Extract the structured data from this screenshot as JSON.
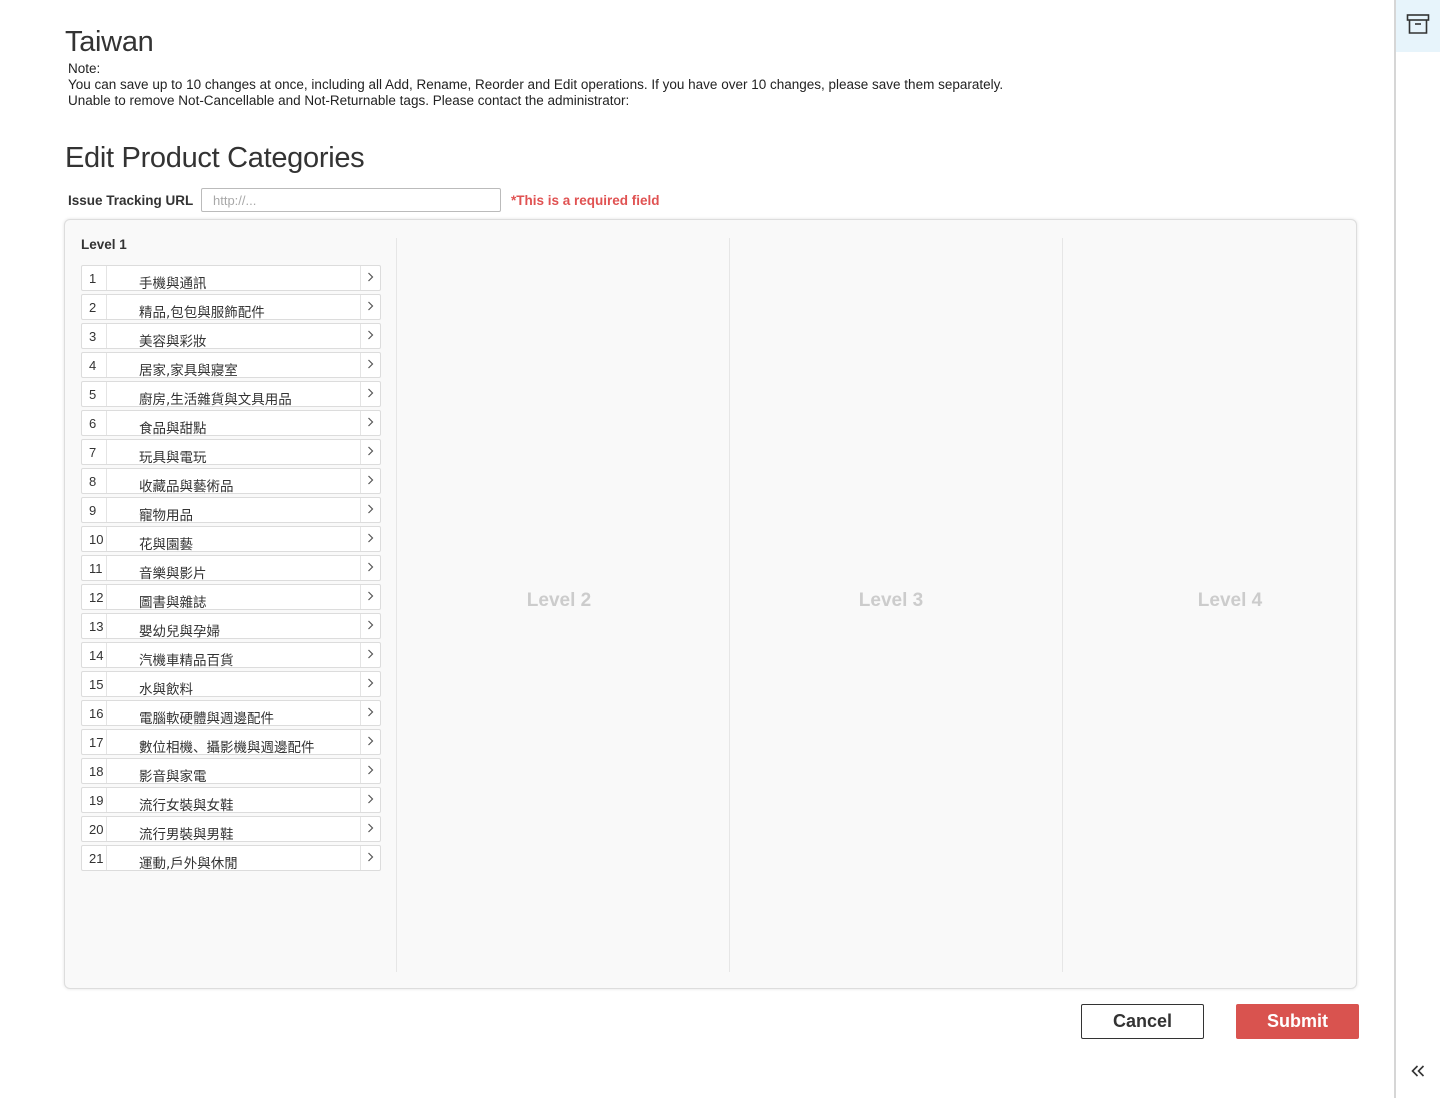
{
  "page": {
    "country_title": "Taiwan",
    "note_lines": [
      "Note:",
      "You can save up to 10 changes at once, including all Add, Rename, Reorder and Edit operations. If you have over 10 changes, please save them separately.",
      "Unable to remove Not-Cancellable and Not-Returnable tags. Please contact the administrator:"
    ],
    "section_title": "Edit Product Categories"
  },
  "tracking_url": {
    "label": "Issue Tracking URL",
    "value": "",
    "placeholder": "http://...",
    "required_text": "*This is a required field"
  },
  "editor": {
    "level1_title": "Level 1",
    "empty_levels": [
      "Level 2",
      "Level 3",
      "Level 4"
    ],
    "categories": [
      {
        "num": "1",
        "name": "手機與通訊"
      },
      {
        "num": "2",
        "name": "精品,包包與服飾配件"
      },
      {
        "num": "3",
        "name": "美容與彩妝"
      },
      {
        "num": "4",
        "name": "居家,家具與寢室"
      },
      {
        "num": "5",
        "name": "廚房,生活雜貨與文具用品"
      },
      {
        "num": "6",
        "name": "食品與甜點"
      },
      {
        "num": "7",
        "name": "玩具與電玩"
      },
      {
        "num": "8",
        "name": "收藏品與藝術品"
      },
      {
        "num": "9",
        "name": "寵物用品"
      },
      {
        "num": "10",
        "name": "花與園藝"
      },
      {
        "num": "11",
        "name": "音樂與影片"
      },
      {
        "num": "12",
        "name": "圖書與雜誌"
      },
      {
        "num": "13",
        "name": "嬰幼兒與孕婦"
      },
      {
        "num": "14",
        "name": "汽機車精品百貨"
      },
      {
        "num": "15",
        "name": "水與飲料"
      },
      {
        "num": "16",
        "name": "電腦軟硬體與週邊配件"
      },
      {
        "num": "17",
        "name": "數位相機、攝影機與週邊配件"
      },
      {
        "num": "18",
        "name": "影音與家電"
      },
      {
        "num": "19",
        "name": "流行女裝與女鞋"
      },
      {
        "num": "20",
        "name": "流行男裝與男鞋"
      },
      {
        "num": "21",
        "name": "運動,戶外與休閒"
      }
    ]
  },
  "actions": {
    "cancel_label": "Cancel",
    "submit_label": "Submit"
  },
  "colors": {
    "required": "#e05252",
    "submit": "#d9534f",
    "rail_highlight": "#e7f4fb",
    "empty_level_text": "#cccccc"
  },
  "icons": {
    "row_expand": "chevron-right-icon",
    "rail_top": "archive-box-icon",
    "rail_bottom": "double-chevron-left-icon"
  }
}
